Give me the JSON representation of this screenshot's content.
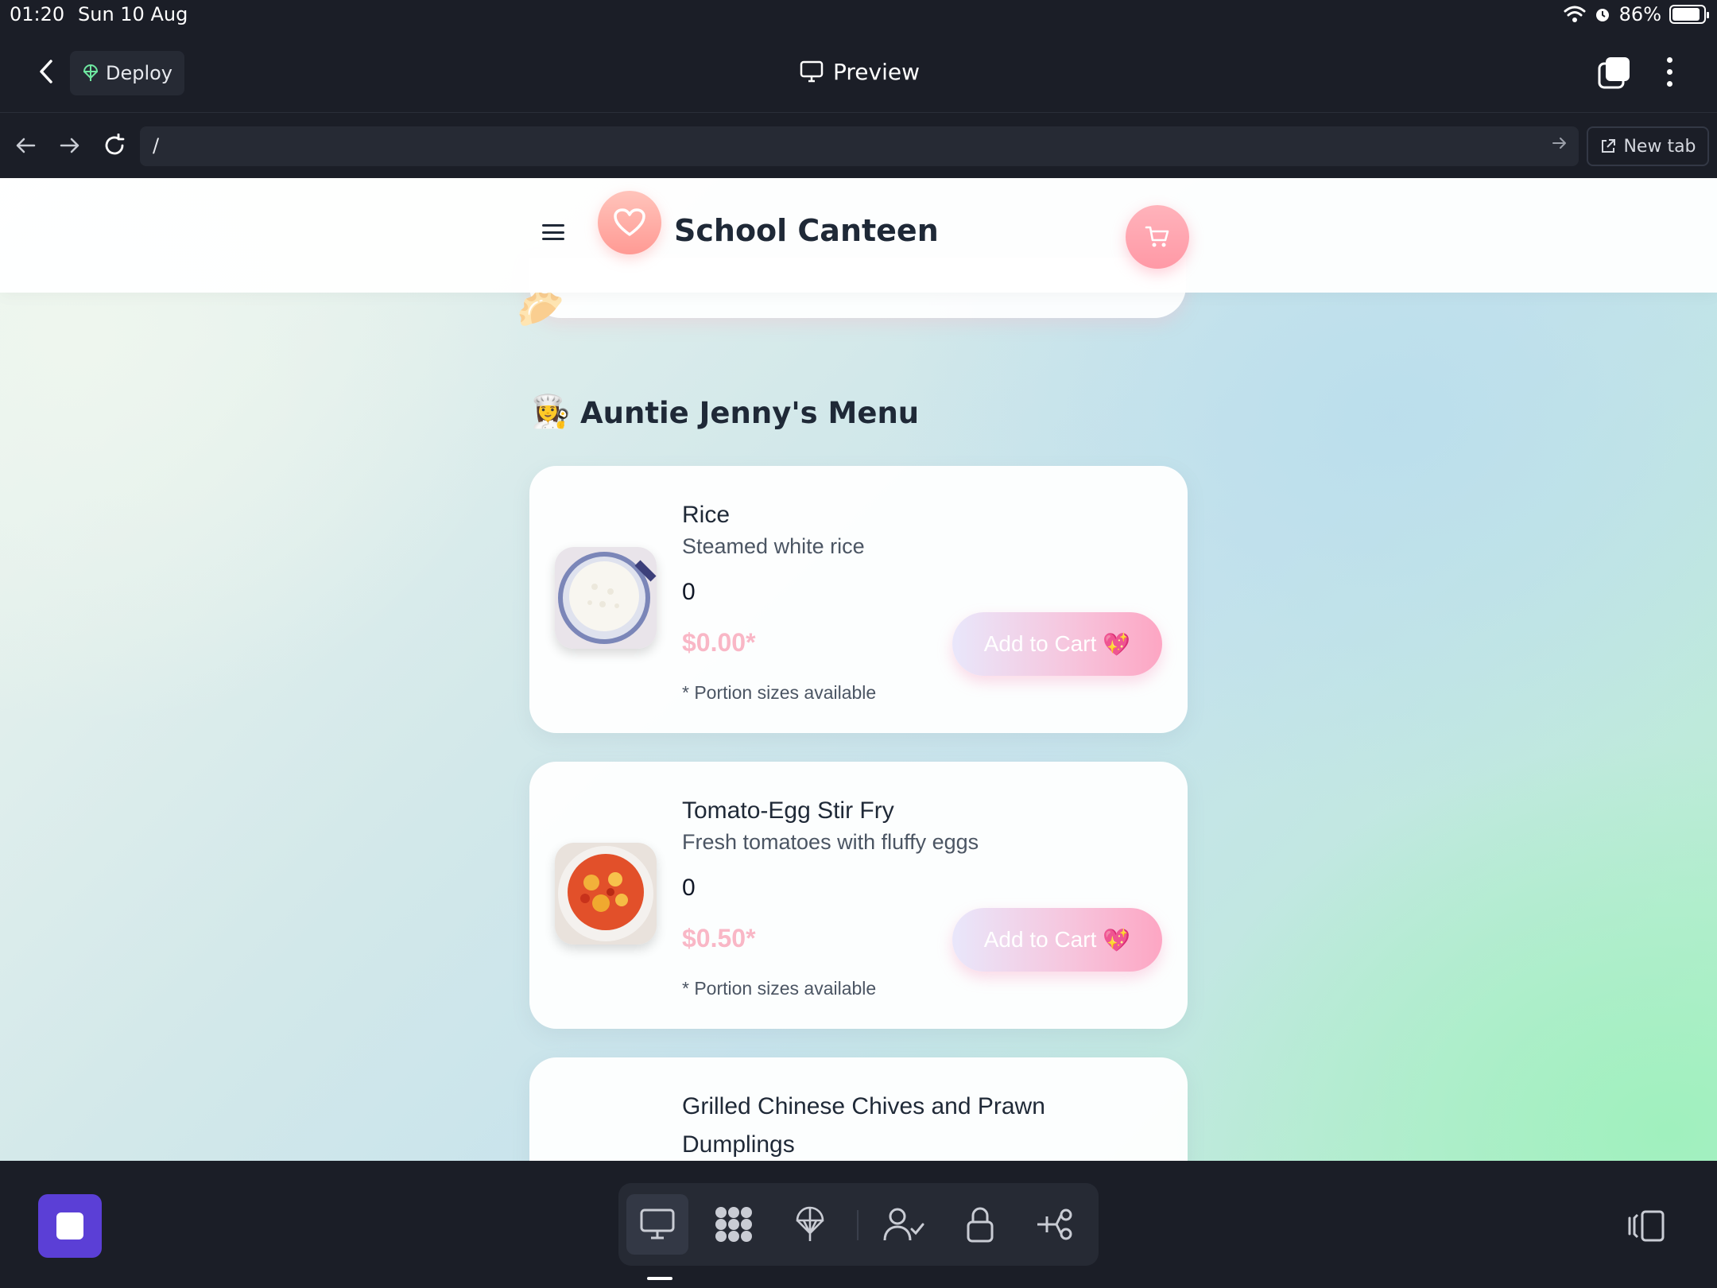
{
  "status_bar": {
    "time": "01:20",
    "date": "Sun 10 Aug",
    "battery": "86%"
  },
  "toolbar": {
    "deploy_label": "Deploy",
    "preview_label": "Preview"
  },
  "url_bar": {
    "path": "/",
    "new_tab_label": "New tab"
  },
  "app": {
    "title": "School Canteen",
    "section_emoji": "👩‍🍳",
    "section_title": "Auntie Jenny's Menu",
    "peek_emoji": "🥟",
    "menu_items": [
      {
        "name": "Rice",
        "description": "Steamed white rice",
        "quantity": "0",
        "price": "$0.00*",
        "note": "* Portion sizes available",
        "button_label": "Add to Cart",
        "button_emoji": "💖"
      },
      {
        "name": "Tomato-Egg Stir Fry",
        "description": "Fresh tomatoes with fluffy eggs",
        "quantity": "0",
        "price": "$0.50*",
        "note": "* Portion sizes available",
        "button_label": "Add to Cart",
        "button_emoji": "💖"
      },
      {
        "name": "Grilled Chinese Chives and Prawn Dumplings"
      }
    ]
  },
  "colors": {
    "accent_pink": "#f9b7c6",
    "stop_button": "#5b3fd6",
    "toolbar_bg": "#1b1e27"
  },
  "icons": {
    "dock": [
      "monitor-icon",
      "apps-icon",
      "deploy-icon",
      "user-check-icon",
      "lock-icon",
      "integrations-icon"
    ],
    "header": [
      "menu-icon",
      "heart-icon",
      "cart-icon"
    ]
  }
}
